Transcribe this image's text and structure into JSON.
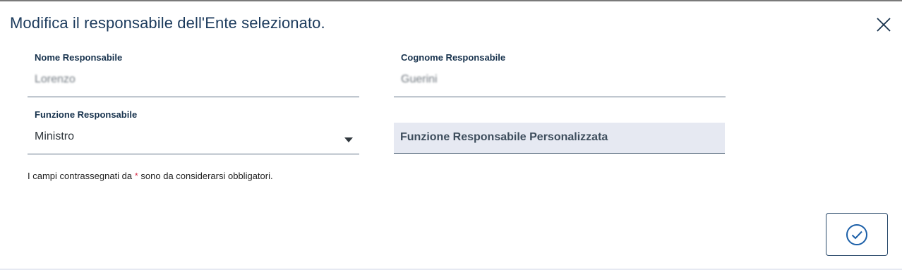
{
  "dialog": {
    "title": "Modifica il responsabile dell'Ente selezionato.",
    "close_icon": "close-icon"
  },
  "form": {
    "nome": {
      "label": "Nome Responsabile",
      "value": "Lorenzo"
    },
    "cognome": {
      "label": "Cognome Responsabile",
      "value": "Guerini"
    },
    "funzione": {
      "label": "Funzione Responsabile",
      "value": "Ministro",
      "icon": "caret-down-icon"
    },
    "funzione_personalizzata": {
      "placeholder": "Funzione Responsabile Personalizzata"
    }
  },
  "note": {
    "prefix": "I campi contrassegnati da ",
    "asterisk": "*",
    "suffix": " sono da considerarsi obbligatori."
  },
  "actions": {
    "confirm_icon": "check-circle-icon"
  },
  "colors": {
    "primary": "#17324d",
    "required": "#d9364f",
    "input_bg": "#e6e9f2"
  }
}
